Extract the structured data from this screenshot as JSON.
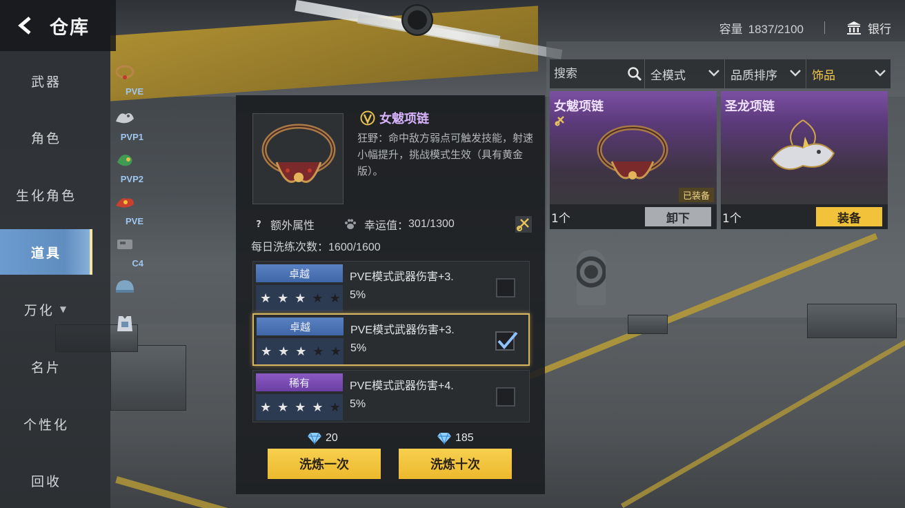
{
  "header": {
    "title": "仓库",
    "back_icon": "back-arrow-icon"
  },
  "storage": {
    "label": "容量",
    "value": "1837/2100"
  },
  "bank": {
    "label": "银行",
    "icon": "bank-icon"
  },
  "left_nav": {
    "items": [
      {
        "label": "武器",
        "active": false
      },
      {
        "label": "角色",
        "active": false
      },
      {
        "label": "生化角色",
        "active": false
      },
      {
        "label": "道具",
        "active": true
      },
      {
        "label": "万化",
        "active": false
      },
      {
        "label": "名片",
        "active": false
      },
      {
        "label": "个性化",
        "active": false
      },
      {
        "label": "回收",
        "active": false
      }
    ]
  },
  "type_tabs": [
    {
      "label": "PVE",
      "icon": "necklace-icon"
    },
    {
      "label": "PVP1",
      "icon": "dragon-charm-icon"
    },
    {
      "label": "PVP2",
      "icon": "green-charm-icon"
    },
    {
      "label": "PVE",
      "icon": "red-charm-icon"
    },
    {
      "label": "C4",
      "icon": "c4-icon"
    },
    {
      "label": "",
      "icon": "helmet-icon"
    },
    {
      "label": "",
      "icon": "armor-icon"
    }
  ],
  "filters": {
    "search_placeholder": "搜索",
    "mode": "全模式",
    "sort": "品质排序",
    "category": "饰品"
  },
  "items": [
    {
      "name": "女魃项链",
      "count": "1个",
      "action": "卸下",
      "equipped_badge": "已装备"
    },
    {
      "name": "圣龙项链",
      "count": "1个",
      "action": "装备"
    }
  ],
  "detail": {
    "name": "女魃项链",
    "description": "狂野：命中敌方弱点可触发技能，射速小幅提升，挑战模式生效（具有黄金版）。",
    "extra_attr_label": "额外属性",
    "luck_label": "幸运值：",
    "luck_value": "301/1300",
    "daily_label": "每日洗练次数：",
    "daily_value": "1600/1600",
    "stats": [
      {
        "tier": "卓越",
        "tier_color": "#4f77b8",
        "stars": 3,
        "text": "PVE模式武器伤害+3.5%",
        "checked": false
      },
      {
        "tier": "卓越",
        "tier_color": "#4f77b8",
        "stars": 3,
        "text": "PVE模式武器伤害+3.5%",
        "checked": true
      },
      {
        "tier": "稀有",
        "tier_color": "#7c4bb6",
        "stars": 4,
        "text": "PVE模式武器伤害+4.5%",
        "checked": false
      }
    ],
    "stat_texts": [
      {
        "line1": "PVE模式武器伤害+3.",
        "line2": "5%"
      },
      {
        "line1": "PVE模式武器伤害+3.",
        "line2": "5%"
      },
      {
        "line1": "PVE模式武器伤害+4.",
        "line2": "5%"
      }
    ],
    "wash_once": {
      "label": "洗炼一次",
      "cost": "20"
    },
    "wash_ten": {
      "label": "洗炼十次",
      "cost": "185"
    }
  },
  "colors": {
    "accent_gold": "#f2c23b",
    "nav_active": "#6c9bd0",
    "epic_purple": "#7b4fa3"
  }
}
